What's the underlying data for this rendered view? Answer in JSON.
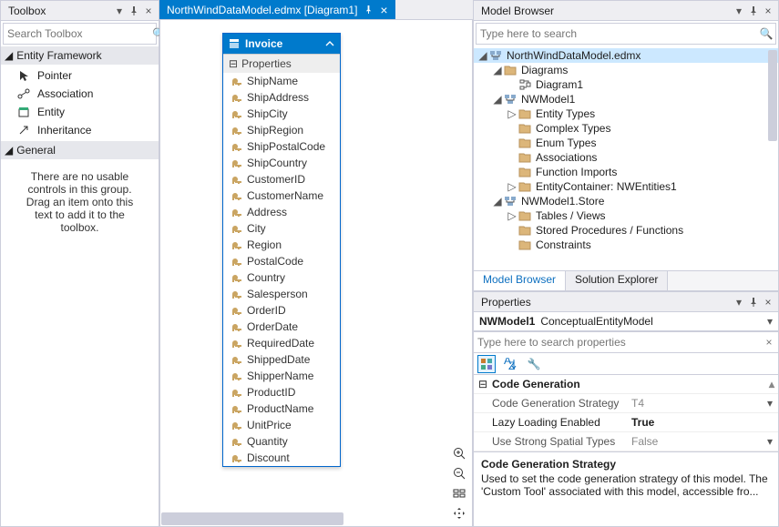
{
  "toolbox": {
    "title": "Toolbox",
    "search_placeholder": "Search Toolbox",
    "groups": [
      {
        "name": "Entity Framework",
        "expanded": true,
        "items": [
          {
            "icon": "pointer",
            "label": "Pointer"
          },
          {
            "icon": "assoc",
            "label": "Association"
          },
          {
            "icon": "entity",
            "label": "Entity"
          },
          {
            "icon": "inherit",
            "label": "Inheritance"
          }
        ]
      },
      {
        "name": "General",
        "expanded": true,
        "empty_text": "There are no usable controls in this group. Drag an item onto this text to add it to the toolbox."
      }
    ]
  },
  "document": {
    "tab_label": "NorthWindDataModel.edmx [Diagram1]"
  },
  "entity": {
    "name": "Invoice",
    "section_label": "Properties",
    "properties": [
      "ShipName",
      "ShipAddress",
      "ShipCity",
      "ShipRegion",
      "ShipPostalCode",
      "ShipCountry",
      "CustomerID",
      "CustomerName",
      "Address",
      "City",
      "Region",
      "PostalCode",
      "Country",
      "Salesperson",
      "OrderID",
      "OrderDate",
      "RequiredDate",
      "ShippedDate",
      "ShipperName",
      "ProductID",
      "ProductName",
      "UnitPrice",
      "Quantity",
      "Discount"
    ]
  },
  "model_browser": {
    "title": "Model Browser",
    "search_placeholder": "Type here to search",
    "tree": {
      "root": "NorthWindDataModel.edmx",
      "diagrams": {
        "label": "Diagrams",
        "items": [
          "Diagram1"
        ]
      },
      "model": {
        "label": "NWModel1",
        "items": [
          "Entity Types",
          "Complex Types",
          "Enum Types",
          "Associations",
          "Function Imports"
        ],
        "container": "EntityContainer: NWEntities1"
      },
      "store": {
        "label": "NWModel1.Store",
        "items": [
          "Tables / Views",
          "Stored Procedures / Functions",
          "Constraints"
        ]
      }
    },
    "tabs": [
      "Model Browser",
      "Solution Explorer"
    ],
    "active_tab": 0
  },
  "properties": {
    "title": "Properties",
    "object_name": "NWModel1",
    "object_type": "ConceptualEntityModel",
    "search_placeholder": "Type here to search properties",
    "category": "Code Generation",
    "rows": [
      {
        "k": "Code Generation Strategy",
        "v": "T4",
        "muted": true,
        "dd": true
      },
      {
        "k": "Lazy Loading Enabled",
        "v": "True",
        "bold": true
      },
      {
        "k": "Use Strong Spatial Types",
        "v": "False",
        "muted": true,
        "dd": true
      }
    ],
    "desc_title": "Code Generation Strategy",
    "desc_body": "Used to set the code generation strategy of this model. The 'Custom Tool' associated with this model, accessible fro..."
  }
}
